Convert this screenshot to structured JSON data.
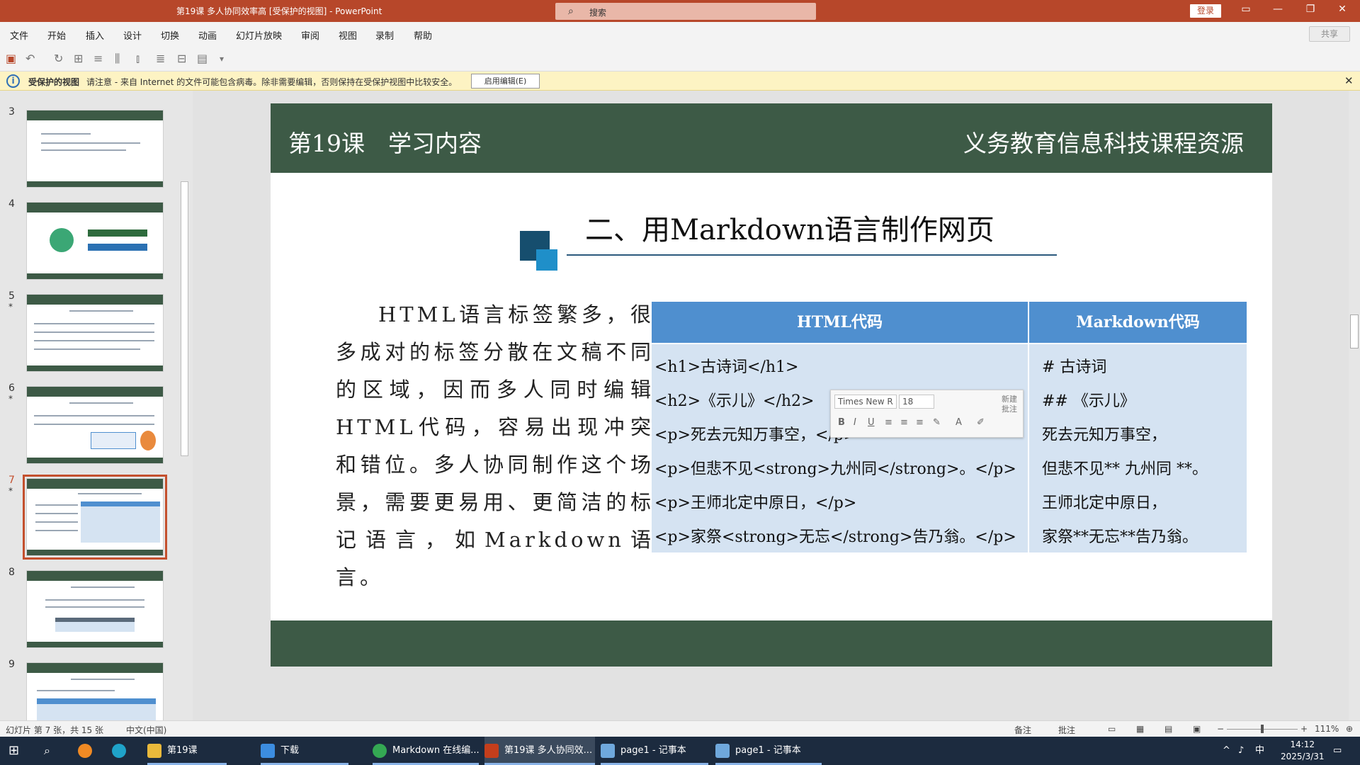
{
  "titlebar": {
    "doc": "第19课 多人协同效率高 [受保护的视图] - PowerPoint",
    "search": "搜索",
    "login": "登录"
  },
  "menu": [
    "文件",
    "开始",
    "插入",
    "设计",
    "切换",
    "动画",
    "幻灯片放映",
    "审阅",
    "视图",
    "录制",
    "帮助"
  ],
  "share": "共享",
  "protect": {
    "title": "受保护的视图",
    "message": "请注意 - 来自 Internet 的文件可能包含病毒。除非需要编辑，否则保持在受保护视图中比较安全。",
    "button": "启用编辑(E)"
  },
  "thumbnails": [
    {
      "num": "3",
      "star": ""
    },
    {
      "num": "4",
      "star": ""
    },
    {
      "num": "5",
      "star": "*"
    },
    {
      "num": "6",
      "star": "*"
    },
    {
      "num": "7",
      "star": "*",
      "selected": true
    },
    {
      "num": "8",
      "star": ""
    },
    {
      "num": "9",
      "star": ""
    }
  ],
  "slide": {
    "header_left": "第19课　学习内容",
    "header_right": "义务教育信息科技课程资源",
    "section_title": "二、用Markdown语言制作网页",
    "body": "HTML语言标签繁多，很多成对的标签分散在文稿不同的区域，因而多人同时编辑HTML代码，容易出现冲突和错位。多人协同制作这个场景，需要更易用、更简洁的标记语言，如Markdown语言。",
    "table": {
      "headers": [
        "HTML代码",
        "Markdown代码"
      ],
      "html": [
        "<h1>古诗词</h1>",
        "<h2>《示儿》</h2>",
        "<p>死去元知万事空，</p>",
        "<p>但悲不见<strong>九州同</strong>。</p>",
        "<p>王师北定中原日，</p>",
        "<p>家祭<strong>无忘</strong>告乃翁。</p>"
      ],
      "markdown": [
        "# 古诗词",
        "## 《示儿》",
        "死去元知万事空，",
        "但悲不见** 九州同 **。",
        "王师北定中原日，",
        "家祭**无忘**告乃翁。"
      ]
    }
  },
  "mini_toolbar": {
    "font": "Times New R",
    "size": "18",
    "comment": "新建批注"
  },
  "status": {
    "slide_info": "幻灯片 第 7 张，共 15 张",
    "language": "中文(中国)",
    "notes": "备注",
    "comments": "批注",
    "zoom": "111%"
  },
  "taskbar": {
    "items": [
      "第19课",
      "下载",
      "Markdown 在线编...",
      "第19课 多人协同效...",
      "page1 - 记事本",
      "page1 - 记事本"
    ],
    "time": "14:12",
    "date": "2025/3/31",
    "ime": "中"
  }
}
